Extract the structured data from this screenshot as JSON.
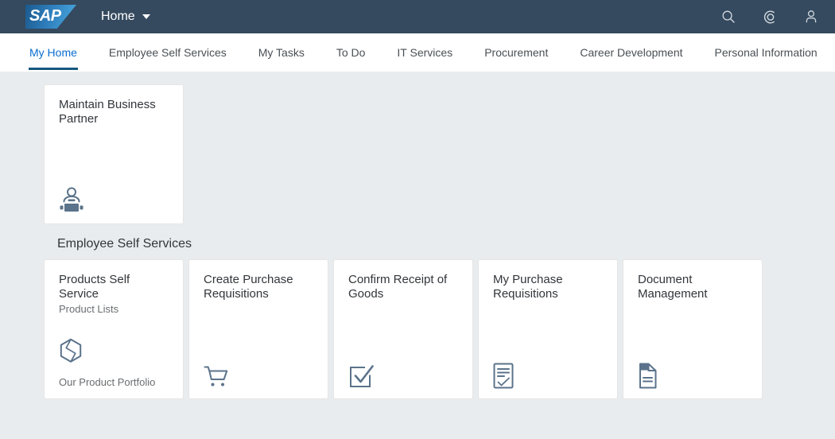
{
  "shell": {
    "logo_text": "SAP",
    "logo_name": "sap-logo",
    "home_label": "Home",
    "actions": [
      {
        "name": "search-icon",
        "label": "Search"
      },
      {
        "name": "copilot-icon",
        "label": "SAP CoPilot"
      },
      {
        "name": "user-avatar-icon",
        "label": "User"
      }
    ]
  },
  "navigation": {
    "tabs": [
      {
        "label": "My Home",
        "active": true
      },
      {
        "label": "Employee Self Services",
        "active": false
      },
      {
        "label": "My Tasks",
        "active": false
      },
      {
        "label": "To Do",
        "active": false
      },
      {
        "label": "IT Services",
        "active": false
      },
      {
        "label": "Procurement",
        "active": false
      },
      {
        "label": "Career Development",
        "active": false
      },
      {
        "label": "Personal Information",
        "active": false
      }
    ]
  },
  "groups": [
    {
      "title": "",
      "tiles": [
        {
          "title": "Maintain Business Partner",
          "subtitle": "",
          "footer": "",
          "icon": "business-partner-icon"
        }
      ]
    },
    {
      "title": "Employee Self Services",
      "tiles": [
        {
          "title": "Products Self Service",
          "subtitle": "Product Lists",
          "footer": "Our Product Portfolio",
          "icon": "product-box-icon"
        },
        {
          "title": "Create Purchase Requisitions",
          "subtitle": "",
          "footer": "",
          "icon": "shopping-cart-icon"
        },
        {
          "title": "Confirm Receipt of Goods",
          "subtitle": "",
          "footer": "",
          "icon": "checkbox-check-icon"
        },
        {
          "title": "My Purchase Requisitions",
          "subtitle": "",
          "footer": "",
          "icon": "task-document-icon"
        },
        {
          "title": "Document Management",
          "subtitle": "",
          "footer": "",
          "icon": "document-page-icon"
        }
      ]
    }
  ],
  "colors": {
    "shell_background": "#354a5f",
    "page_background": "#e9ecee",
    "tile_background": "#ffffff",
    "active_tab": "#0a6ed1",
    "active_tab_underline": "#15577e",
    "icon_color": "#5b738b",
    "title_text": "#32363a",
    "subtitle_text": "#6a6d70"
  }
}
